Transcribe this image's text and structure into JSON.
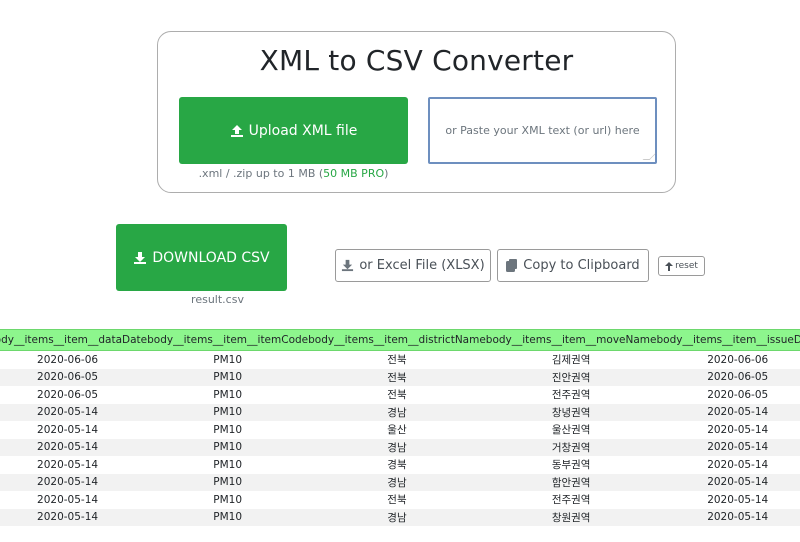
{
  "header": {
    "title": "XML to CSV Converter"
  },
  "upload": {
    "label": "Upload XML file",
    "note_prefix": ".xml / .zip up to 1 MB (",
    "note_pro": "50 MB PRO",
    "note_suffix": ")"
  },
  "paste": {
    "placeholder": "or Paste your XML text (or url) here"
  },
  "download": {
    "label": "DOWNLOAD CSV",
    "filename": "result.csv"
  },
  "excel": {
    "label": "or Excel File (XLSX)"
  },
  "copy": {
    "label": "Copy to Clipboard"
  },
  "reset": {
    "label": "reset"
  },
  "colors": {
    "primary_green": "#28a745",
    "header_green": "#8df68d"
  },
  "table": {
    "columns": [
      "body__items__item__dataDate",
      "body__items__item__itemCode",
      "body__items__item__districtName",
      "body__items__item__moveName",
      "body__items__item__issueDate"
    ],
    "rows": [
      [
        "2020-06-06",
        "PM10",
        "전북",
        "김제권역",
        "2020-06-06"
      ],
      [
        "2020-06-05",
        "PM10",
        "전북",
        "진안권역",
        "2020-06-05"
      ],
      [
        "2020-06-05",
        "PM10",
        "전북",
        "전주권역",
        "2020-06-05"
      ],
      [
        "2020-05-14",
        "PM10",
        "경남",
        "창녕권역",
        "2020-05-14"
      ],
      [
        "2020-05-14",
        "PM10",
        "울산",
        "울산권역",
        "2020-05-14"
      ],
      [
        "2020-05-14",
        "PM10",
        "경남",
        "거창권역",
        "2020-05-14"
      ],
      [
        "2020-05-14",
        "PM10",
        "경북",
        "동부권역",
        "2020-05-14"
      ],
      [
        "2020-05-14",
        "PM10",
        "경남",
        "함안권역",
        "2020-05-14"
      ],
      [
        "2020-05-14",
        "PM10",
        "전북",
        "전주권역",
        "2020-05-14"
      ],
      [
        "2020-05-14",
        "PM10",
        "경남",
        "창원권역",
        "2020-05-14"
      ]
    ]
  }
}
